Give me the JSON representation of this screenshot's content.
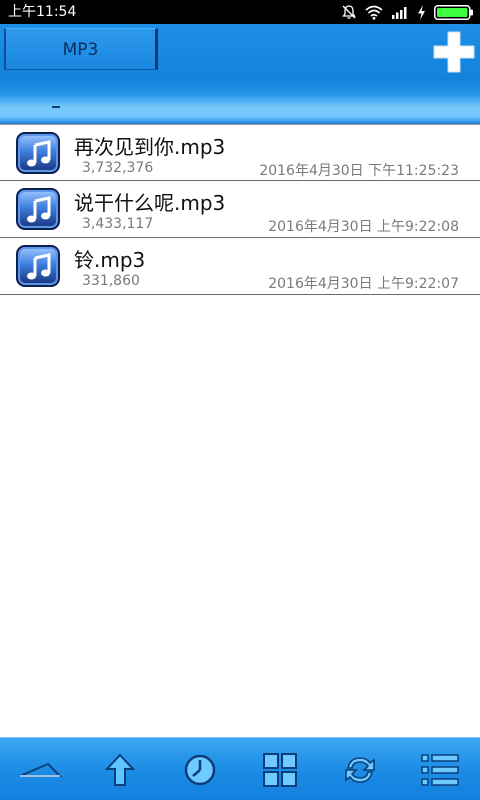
{
  "status_bar": {
    "time": "上午11:54",
    "icons": [
      "alarm-off-icon",
      "wifi-icon",
      "signal-icon",
      "charging-icon",
      "battery-icon"
    ]
  },
  "header": {
    "tab_label": "MP3",
    "path_marker": "_",
    "add_icon": "plus-icon"
  },
  "files": [
    {
      "name": "再次见到你.mp3",
      "size": "3,732,376",
      "date": "2016年4月30日 下午11:25:23"
    },
    {
      "name": "说干什么呢.mp3",
      "size": "3,433,117",
      "date": "2016年4月30日 上午9:22:08"
    },
    {
      "name": "铃.mp3",
      "size": "331,860",
      "date": "2016年4月30日 上午9:22:07"
    }
  ],
  "toolbar": {
    "buttons": [
      "expand-icon",
      "up-arrow-icon",
      "clock-icon",
      "grid-icon",
      "refresh-icon",
      "list-menu-icon"
    ]
  },
  "colors": {
    "accent": "#1a86df",
    "battery": "#3dff3d"
  }
}
